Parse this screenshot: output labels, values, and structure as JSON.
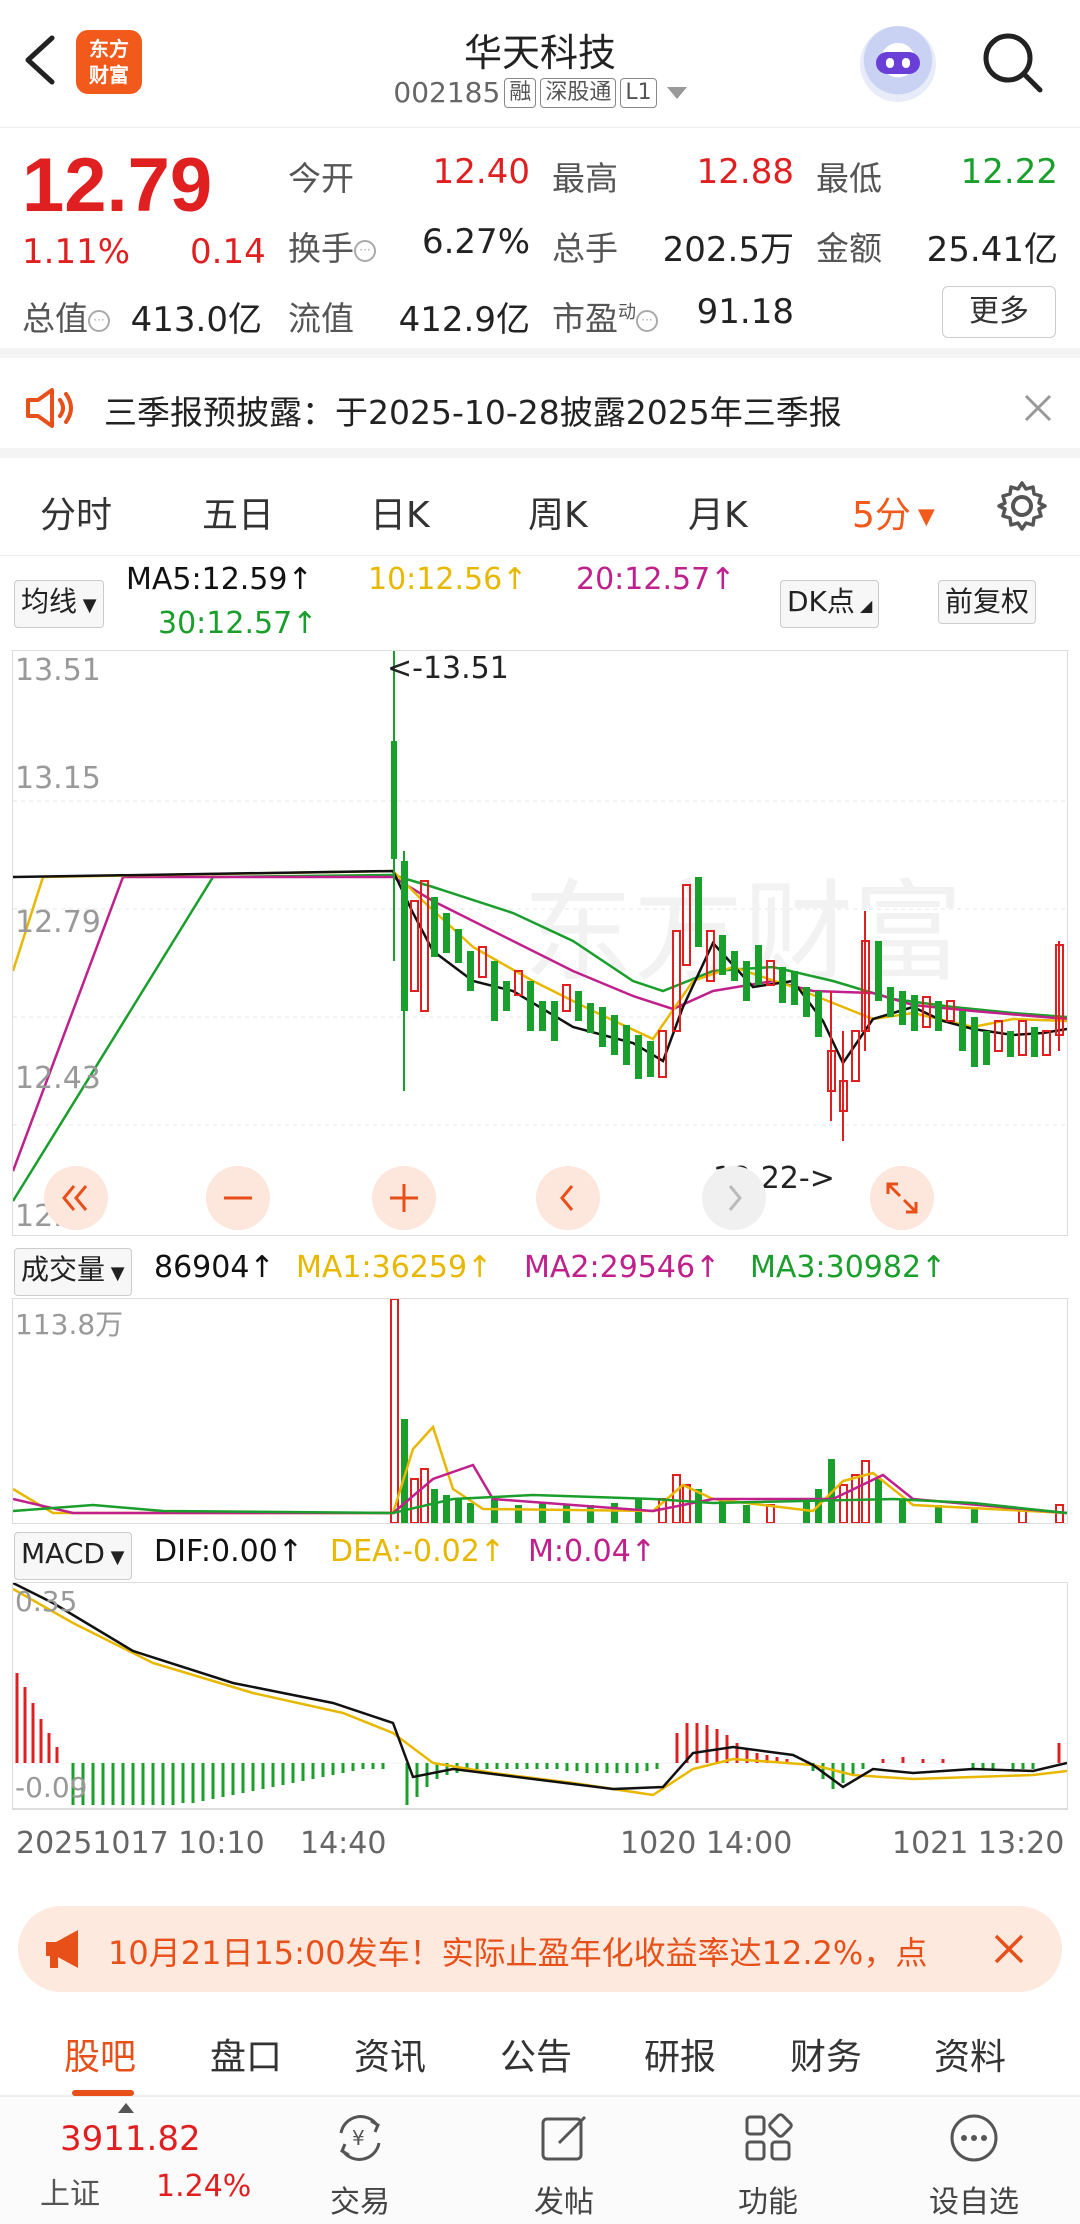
{
  "header": {
    "stock_name": "华天科技",
    "stock_code": "002185",
    "tags": [
      "融",
      "深股通",
      "L1"
    ],
    "logo_text_line1": "东方",
    "logo_text_line2": "财富"
  },
  "quote": {
    "price": "12.79",
    "change_pct": "1.11%",
    "change_amt": "0.14",
    "fields": {
      "open_label": "今开",
      "open": "12.40",
      "high_label": "最高",
      "high": "12.88",
      "low_label": "最低",
      "low": "12.22",
      "turnover_label": "换手",
      "turnover": "6.27%",
      "volume_label": "总手",
      "volume": "202.5万",
      "amount_label": "金额",
      "amount": "25.41亿",
      "mktcap_label": "总值",
      "mktcap": "413.0亿",
      "float_label": "流值",
      "float": "412.9亿",
      "pe_label": "市盈",
      "pe_sup": "动",
      "pe": "91.18"
    },
    "more_label": "更多"
  },
  "notice": {
    "text": "三季报预披露：于2025-10-28披露2025年三季报"
  },
  "period_tabs": [
    "分时",
    "五日",
    "日K",
    "周K",
    "月K",
    "5分"
  ],
  "period_active": "5分",
  "kline": {
    "indicator_select": "均线",
    "ma5": "MA5:12.59↑",
    "ma10": "10:12.56↑",
    "ma20": "20:12.57↑",
    "ma30": "30:12.57↑",
    "dk_button": "DK点",
    "adjust_button": "前复权",
    "y_ticks": [
      "13.51",
      "13.15",
      "12.79",
      "12.43",
      "12.07"
    ],
    "max_marker": "<-13.51",
    "min_marker": "12.22->"
  },
  "volume": {
    "select": "成交量",
    "value": "86904↑",
    "ma1": "MA1:36259↑",
    "ma2": "MA2:29546↑",
    "ma3": "MA3:30982↑",
    "max_label": "113.8万"
  },
  "macd": {
    "select": "MACD",
    "dif": "DIF:0.00↑",
    "dea": "DEA:-0.02↑",
    "m": "M:0.04↑",
    "top_label": "0.35",
    "bottom_label": "-0.09"
  },
  "time_axis": [
    "20251017 10:10",
    "14:40",
    "1020 14:00",
    "1021 13:20"
  ],
  "banner": {
    "text": "10月21日15:00发车！实际止盈年化收益率达12.2%，点"
  },
  "sub_tabs": [
    "股吧",
    "盘口",
    "资讯",
    "公告",
    "研报",
    "财务",
    "资料"
  ],
  "sub_tab_active": "股吧",
  "bottom_nav": {
    "index_value": "3911.82",
    "index_name": "上证",
    "index_pct": "1.24%",
    "items": [
      "交易",
      "发帖",
      "功能",
      "设自选"
    ]
  },
  "colors": {
    "up": "#e02020",
    "down": "#1a9e2c",
    "accent": "#f25a1c",
    "ma5": "#111111",
    "ma10": "#e8b800",
    "ma20": "#c0208c",
    "ma30": "#1a9e2c"
  }
}
